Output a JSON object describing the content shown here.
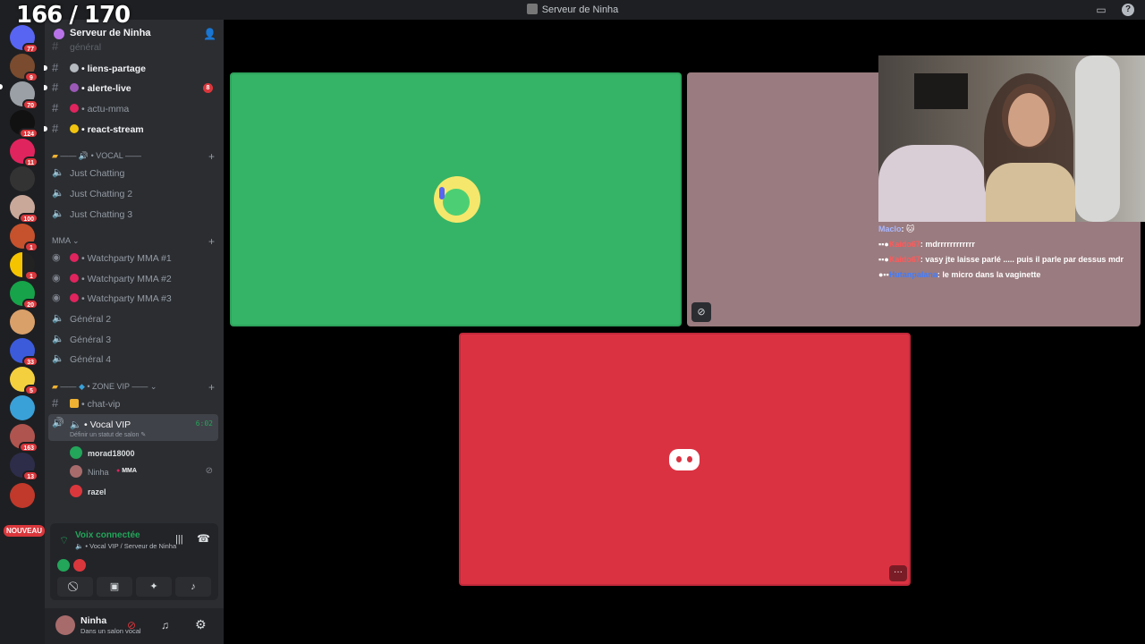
{
  "counter": "166 / 170",
  "window": {
    "title": "Serveur de Ninha"
  },
  "guild_badges": [
    "77",
    "9",
    "70",
    "124",
    "11",
    "100",
    "1",
    "1",
    "20",
    "33",
    "5",
    "163",
    "13"
  ],
  "guild_new_label": "NOUVEAU",
  "server": {
    "name": "Serveur de Ninha"
  },
  "channels": {
    "general_partial": "général",
    "text1": "liens-partage",
    "text2": "alerte-live",
    "text2_badge": "8",
    "text3": "actu-mma",
    "text4": "react-stream",
    "cat_vocal": "VOCAL",
    "voice1": "Just Chatting",
    "voice2": "Just Chatting 2",
    "voice3": "Just Chatting 3",
    "cat_mma": "MMA",
    "stage1": "Watchparty MMA #1",
    "stage2": "Watchparty MMA #2",
    "stage3": "Watchparty MMA #3",
    "voice4": "Général 2",
    "voice5": "Général 3",
    "voice6": "Général 4",
    "cat_vip": "ZONE VIP",
    "text_vip": "chat-vip",
    "active_voice": "Vocal VIP",
    "active_timer": "6:02",
    "active_status": "Définir un statut de salon"
  },
  "members": [
    {
      "name": "morad18000"
    },
    {
      "name": "Ninha",
      "tag": "MMA"
    },
    {
      "name": "razel"
    }
  ],
  "voice_panel": {
    "title": "Voix connectée",
    "subtitle": "Vocal VIP / Serveur de Ninha"
  },
  "user": {
    "name": "Ninha",
    "status": "Dans un salon vocal"
  },
  "chat": [
    {
      "user": "Maclo",
      "msg": ": 🐱"
    },
    {
      "user": "Kaido67",
      "msg": ": mdrrrrrrrrrrrr"
    },
    {
      "user": "Kaido67",
      "msg": ": vasy jte laisse parlé ..... puis il parle par dessus mdr"
    },
    {
      "user": "Hutanpalana",
      "msg": ": le micro dans la vaginette"
    }
  ],
  "colors": {
    "tile_green": "#35b467",
    "tile_mauve": "#9a7b7f",
    "tile_red": "#db3242",
    "accent_green": "#23a55a",
    "badge_red": "#da373c"
  }
}
